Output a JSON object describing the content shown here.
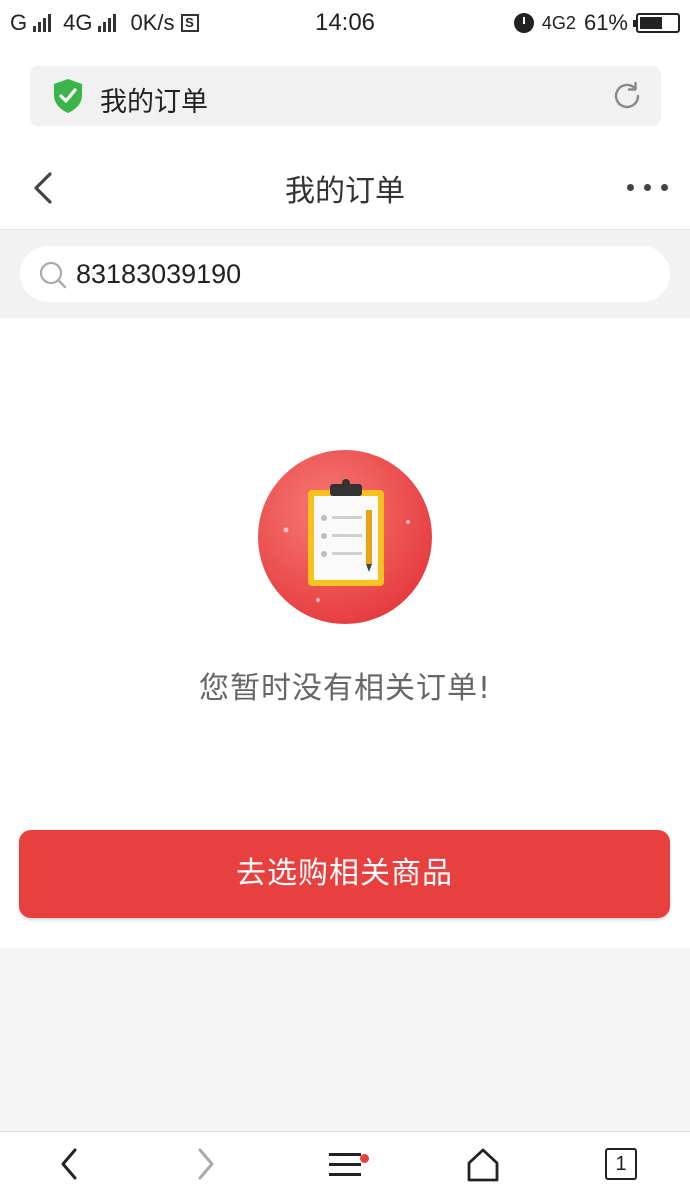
{
  "status_bar": {
    "carrier1": "G",
    "carrier2": "4G",
    "speed": "0K/s",
    "s_icon": "S",
    "time": "14:06",
    "network_right": "4G2",
    "battery": "61%"
  },
  "browser": {
    "url_text": "我的订单"
  },
  "header": {
    "title": "我的订单"
  },
  "search": {
    "value": "83183039190"
  },
  "empty_state": {
    "message": "您暂时没有相关订单!",
    "button_label": "去选购相关商品"
  },
  "bottom_nav": {
    "tab_count": "1"
  },
  "colors": {
    "accent": "#e8403f",
    "shield": "#3bb54a"
  },
  "icons": [
    "shield-check-icon",
    "reload-icon",
    "back-arrow-icon",
    "more-icon",
    "search-icon",
    "clipboard-icon",
    "nav-back-icon",
    "nav-forward-icon",
    "menu-icon",
    "home-icon",
    "tabs-icon"
  ]
}
